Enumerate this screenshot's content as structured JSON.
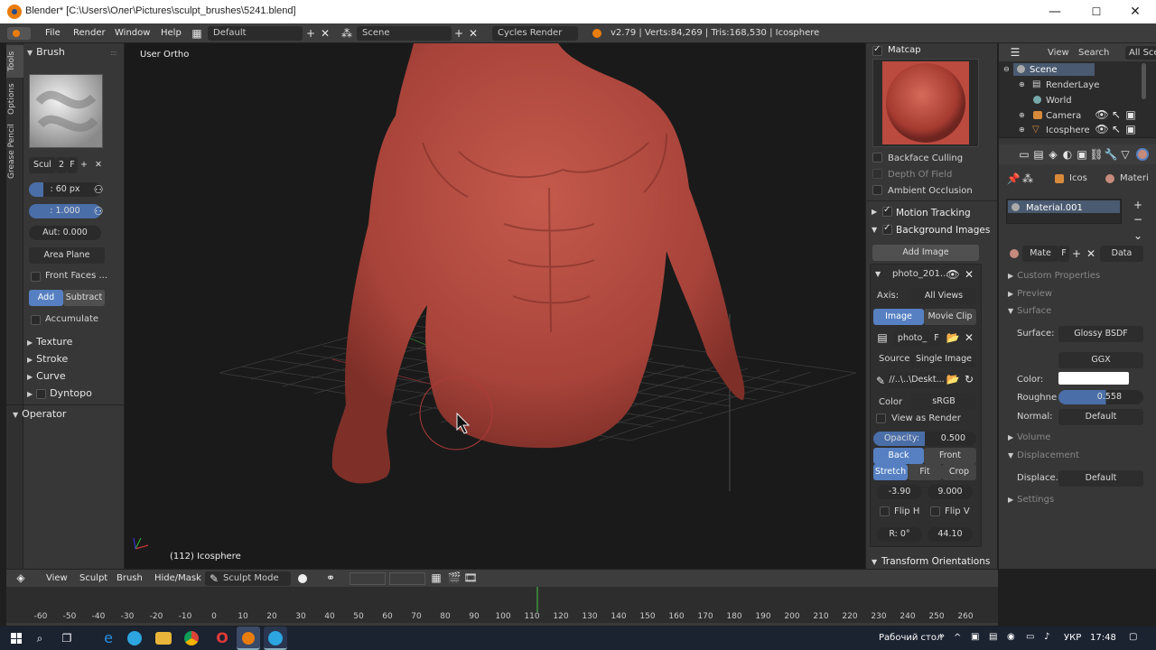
{
  "window": {
    "title": "Blender* [C:\\Users\\Олег\\Pictures\\sculpt_brushes\\5241.blend]",
    "minimize": "—",
    "maximize": "☐",
    "close": "✕"
  },
  "info_header": {
    "menus": [
      "File",
      "Render",
      "Window",
      "Help"
    ],
    "screen_layout": "Default",
    "scene": "Scene",
    "render_engine": "Cycles Render",
    "stats": "v2.79 | Verts:84,269 | Tris:168,530 | Icosphere"
  },
  "left_tabs": [
    "Tools",
    "Options",
    "Grease Pencil"
  ],
  "toolshelf": {
    "brush_header": "Brush",
    "brush_name": "Scul",
    "brush_users": "2",
    "brush_fake": "F",
    "radius": ": 60 px",
    "strength": ": 1.000",
    "autosmooth": "Aut: 0.000",
    "plane": "Area Plane",
    "front_faces": "Front Faces ...",
    "add": "Add",
    "subtract": "Subtract",
    "accumulate": "Accumulate",
    "sections": [
      "Texture",
      "Stroke",
      "Curve",
      "Dyntopo"
    ],
    "operator": "Operator"
  },
  "viewport": {
    "view_label": "User Ortho",
    "object_label": "(112) Icosphere"
  },
  "npanel": {
    "matcap": "Matcap",
    "backface_culling": "Backface Culling",
    "depth_of_field": "Depth Of Field",
    "ambient_occlusion": "Ambient Occlusion",
    "motion_tracking": "Motion Tracking",
    "background_images": "Background Images",
    "add_image": "Add Image",
    "image_name": "photo_201...",
    "axis_label": "Axis:",
    "axis_value": "All Views",
    "tab_image": "Image",
    "tab_movie": "Movie Clip",
    "image_field": "photo_",
    "image_fake": "F",
    "source_label": "Source",
    "source_value": "Single Image",
    "filepath": "//..\\..\\Deskt...",
    "color_label": "Color",
    "color_value": "sRGB",
    "view_as_render": "View as Render",
    "opacity_label": "Opacity:",
    "opacity_value": "0.500",
    "opacity_fraction": 0.5,
    "back": "Back",
    "front": "Front",
    "stretch": "Stretch",
    "fit": "Fit",
    "crop": "Crop",
    "offset_x": "-3.90",
    "offset_y": "9.000",
    "flip_h": "Flip H",
    "flip_v": "Flip V",
    "rotation": "R: 0°",
    "size": "44.10",
    "transform_orientations": "Transform Orientations"
  },
  "outliner": {
    "view": "View",
    "search": "Search",
    "filter": "All Scene",
    "items": [
      "Scene",
      "RenderLaye",
      "World",
      "Camera",
      "Icosphere"
    ]
  },
  "properties": {
    "context_object": "Icos",
    "context_material": "Materi",
    "material_slot": "Material.001",
    "material_name": "Mate",
    "material_fake": "F",
    "data": "Data",
    "sections": [
      "Custom Properties",
      "Preview",
      "Surface"
    ],
    "surface_label": "Surface:",
    "surface_value": "Glossy BSDF",
    "distribution": "GGX",
    "color_label": "Color:",
    "color_value": "#ffffff",
    "roughness_label": "Roughne",
    "roughness_value": "0.558",
    "roughness_fraction": 0.558,
    "normal_label": "Normal:",
    "normal_value": "Default",
    "volume": "Volume",
    "displacement": "Displacement",
    "displace_label": "Displace...",
    "displace_value": "Default",
    "settings": "Settings"
  },
  "bottom_header": {
    "menus": [
      "View",
      "Sculpt",
      "Brush",
      "Hide/Mask"
    ],
    "mode": "Sculpt Mode"
  },
  "timeline": {
    "ticks": [
      "-60",
      "-50",
      "-40",
      "-30",
      "-20",
      "-10",
      "0",
      "10",
      "20",
      "30",
      "40",
      "50",
      "60",
      "70",
      "80",
      "90",
      "100",
      "110",
      "120",
      "130",
      "140",
      "150",
      "160",
      "170",
      "180",
      "190",
      "200",
      "210",
      "220",
      "230",
      "240",
      "250",
      "260"
    ],
    "current_frame": 112
  },
  "taskbar": {
    "desktop_label": "Рабочий стол",
    "language": "УКР",
    "time": "17:48"
  },
  "colors": {
    "accent": "#5680c2",
    "skin": "#b5483c",
    "matcap": "#b8443a"
  }
}
